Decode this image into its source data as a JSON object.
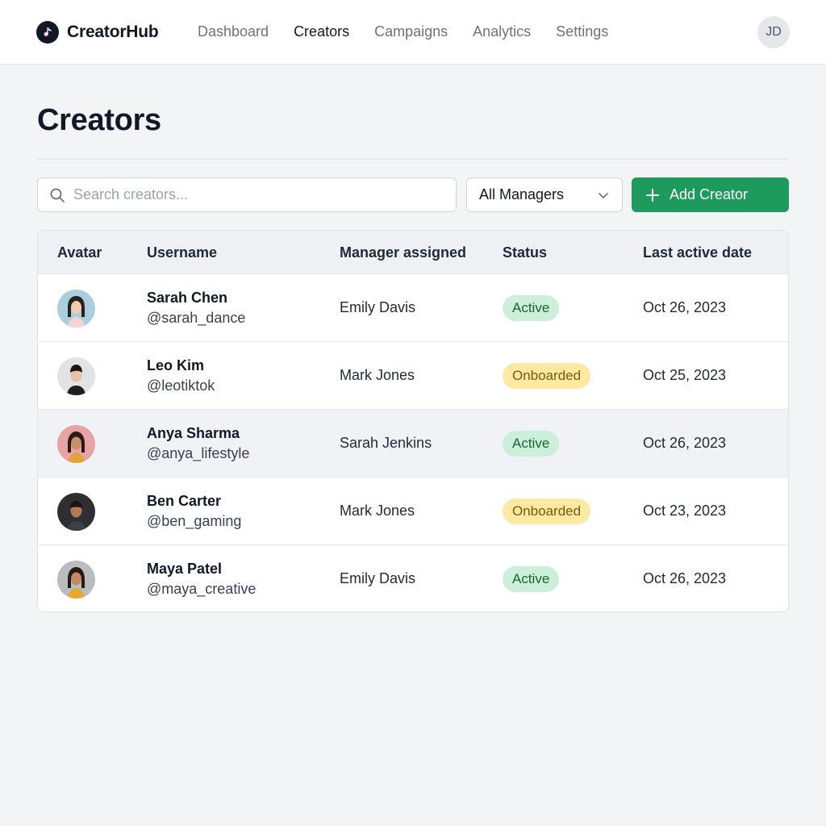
{
  "brand": {
    "name": "CreatorHub",
    "logo_icon": "music-note-icon"
  },
  "nav": {
    "items": [
      {
        "label": "Dashboard",
        "active": false
      },
      {
        "label": "Creators",
        "active": true
      },
      {
        "label": "Campaigns",
        "active": false
      },
      {
        "label": "Analytics",
        "active": false
      },
      {
        "label": "Settings",
        "active": false
      }
    ],
    "user_initials": "JD"
  },
  "page": {
    "title": "Creators"
  },
  "toolbar": {
    "search_placeholder": "Search creators...",
    "search_value": "",
    "manager_filter": "All Managers",
    "add_button": "Add Creator"
  },
  "table": {
    "headers": {
      "avatar": "Avatar",
      "username": "Username",
      "manager": "Manager assigned",
      "status": "Status",
      "last_active": "Last active date"
    },
    "rows": [
      {
        "name": "Sarah Chen",
        "handle": "@sarah_dance",
        "manager": "Emily Davis",
        "status": "Active",
        "status_kind": "active",
        "date": "Oct 26, 2023"
      },
      {
        "name": "Leo Kim",
        "handle": "@leotiktok",
        "manager": "Mark Jones",
        "status": "Onboarded",
        "status_kind": "onboarded",
        "date": "Oct 25, 2023"
      },
      {
        "name": "Anya Sharma",
        "handle": "@anya_lifestyle",
        "manager": "Sarah Jenkins",
        "status": "Active",
        "status_kind": "active",
        "date": "Oct 26, 2023"
      },
      {
        "name": "Ben Carter",
        "handle": "@ben_gaming",
        "manager": "Mark Jones",
        "status": "Onboarded",
        "status_kind": "onboarded",
        "date": "Oct 23, 2023"
      },
      {
        "name": "Maya Patel",
        "handle": "@maya_creative",
        "manager": "Emily Davis",
        "status": "Active",
        "status_kind": "active",
        "date": "Oct 26, 2023"
      }
    ]
  },
  "colors": {
    "accent": "#1e9a5e",
    "active_bg": "#ccefd9",
    "active_text": "#166534",
    "onboarded_bg": "#fde9a3",
    "onboarded_text": "#7c5a06"
  }
}
